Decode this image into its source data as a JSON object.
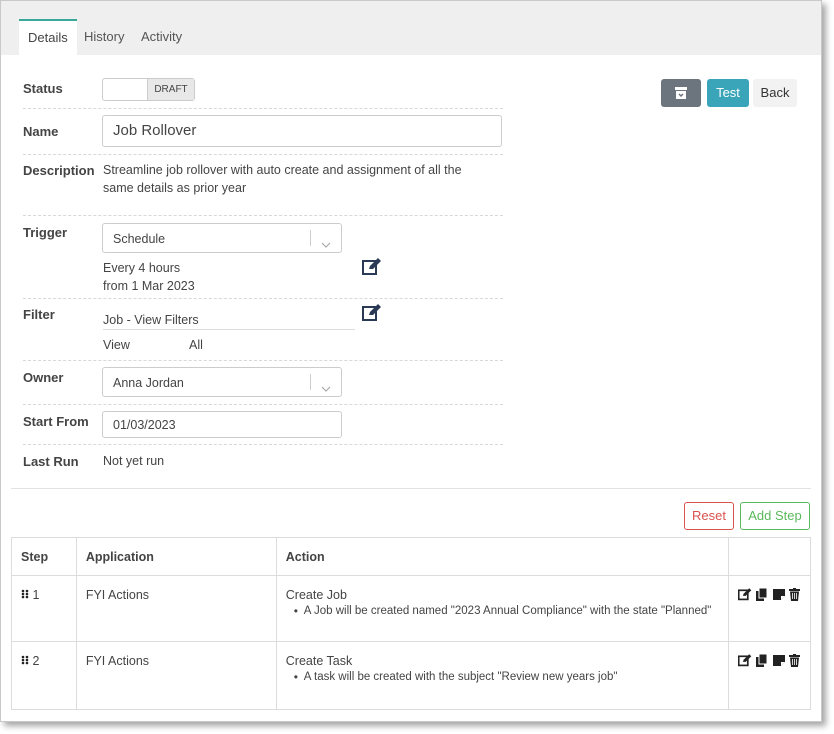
{
  "tabs": [
    {
      "label": "Details"
    },
    {
      "label": "History"
    },
    {
      "label": "Activity"
    }
  ],
  "toolbar": {
    "archive_icon": "archive-icon",
    "test_label": "Test",
    "back_label": "Back"
  },
  "status": {
    "label": "Status",
    "toggle_text": "DRAFT"
  },
  "name": {
    "label": "Name",
    "value": "Job Rollover"
  },
  "description": {
    "label": "Description",
    "text": "Streamline job rollover with auto create and assignment of all the same details as prior year"
  },
  "trigger": {
    "label": "Trigger",
    "selected": "Schedule",
    "detail_line1": "Every 4 hours",
    "detail_line2": "from 1 Mar 2023"
  },
  "filter": {
    "label": "Filter",
    "title": "Job - View Filters",
    "key": "View",
    "value": "All"
  },
  "owner": {
    "label": "Owner",
    "selected": "Anna Jordan"
  },
  "start_from": {
    "label": "Start From",
    "value": "01/03/2023"
  },
  "last_run": {
    "label": "Last Run",
    "value": "Not yet run"
  },
  "actions": {
    "reset_label": "Reset",
    "add_step_label": "Add Step"
  },
  "table": {
    "headers": [
      "Step",
      "Application",
      "Action",
      ""
    ],
    "rows": [
      {
        "step": "1",
        "application": "FYI Actions",
        "action": "Create Job",
        "detail": "A Job will be created named \"2023 Annual Compliance\" with the state \"Planned\""
      },
      {
        "step": "2",
        "application": "FYI Actions",
        "action": "Create Task",
        "detail": "A task will be created with the subject \"Review new years job\""
      }
    ]
  },
  "colors": {
    "accent": "#3aa89a",
    "test_button": "#3aa4b8",
    "archive_button": "#6c757d",
    "reset": "#d9534f",
    "add_step": "#5cb85c"
  }
}
